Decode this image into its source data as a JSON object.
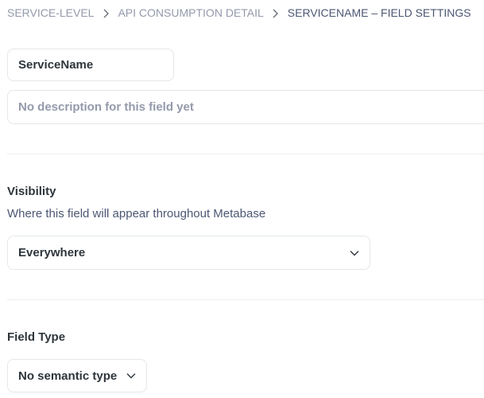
{
  "breadcrumb": {
    "items": [
      {
        "label": "SERVICE-LEVEL"
      },
      {
        "label": "API CONSUMPTION DETAIL"
      },
      {
        "label": "SERVICENAME – FIELD SETTINGS"
      }
    ]
  },
  "field": {
    "name_value": "ServiceName",
    "description_value": "",
    "description_placeholder": "No description for this field yet"
  },
  "visibility": {
    "title": "Visibility",
    "description": "Where this field will appear throughout Metabase",
    "selected": "Everywhere"
  },
  "field_type": {
    "title": "Field Type",
    "selected": "No semantic type"
  },
  "colors": {
    "text_primary": "#2e353b",
    "text_muted": "#949aab",
    "text_secondary": "#4c5773",
    "border": "#e4e7ea"
  },
  "icons": {
    "breadcrumb_separator": "chevron-right-icon",
    "select_caret": "chevron-down-icon"
  }
}
